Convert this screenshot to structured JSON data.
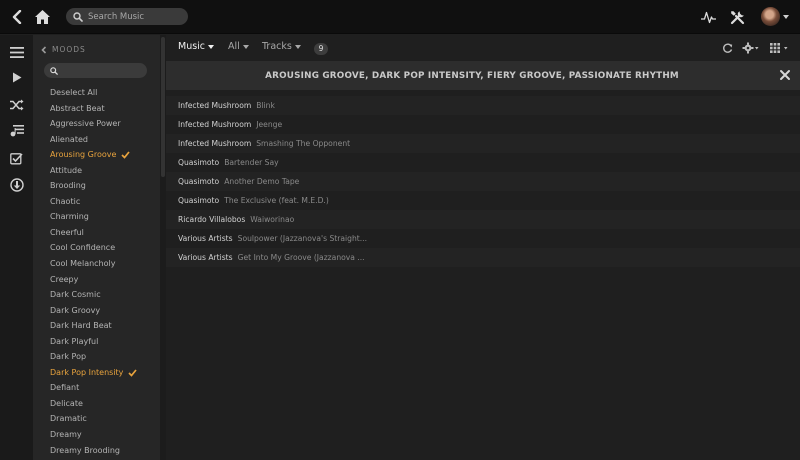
{
  "topbar": {
    "search_placeholder": "Search Music"
  },
  "rail": {
    "items": [
      "menu-icon",
      "play-icon",
      "shuffle-icon",
      "playlists-icon",
      "checklist-icon",
      "download-icon"
    ]
  },
  "moods": {
    "header": "MOODS",
    "items": [
      {
        "label": "Deselect All",
        "selected": false
      },
      {
        "label": "Abstract Beat",
        "selected": false
      },
      {
        "label": "Aggressive Power",
        "selected": false
      },
      {
        "label": "Alienated",
        "selected": false
      },
      {
        "label": "Arousing Groove",
        "selected": true
      },
      {
        "label": "Attitude",
        "selected": false
      },
      {
        "label": "Brooding",
        "selected": false
      },
      {
        "label": "Chaotic",
        "selected": false
      },
      {
        "label": "Charming",
        "selected": false
      },
      {
        "label": "Cheerful",
        "selected": false
      },
      {
        "label": "Cool Confidence",
        "selected": false
      },
      {
        "label": "Cool Melancholy",
        "selected": false
      },
      {
        "label": "Creepy",
        "selected": false
      },
      {
        "label": "Dark Cosmic",
        "selected": false
      },
      {
        "label": "Dark Groovy",
        "selected": false
      },
      {
        "label": "Dark Hard Beat",
        "selected": false
      },
      {
        "label": "Dark Playful",
        "selected": false
      },
      {
        "label": "Dark Pop",
        "selected": false
      },
      {
        "label": "Dark Pop Intensity",
        "selected": true
      },
      {
        "label": "Defiant",
        "selected": false
      },
      {
        "label": "Delicate",
        "selected": false
      },
      {
        "label": "Dramatic",
        "selected": false
      },
      {
        "label": "Dreamy",
        "selected": false
      },
      {
        "label": "Dreamy Brooding",
        "selected": false
      }
    ],
    "accent_color": "#e8a33d"
  },
  "main": {
    "tabs": {
      "music": "Music",
      "all": "All",
      "tracks": "Tracks"
    },
    "count": "9",
    "filter_title": "AROUSING GROOVE, DARK POP INTENSITY, FIERY GROOVE, PASSIONATE RHYTHM",
    "tracks": [
      {
        "artist": "Infected Mushroom",
        "title": "Blink"
      },
      {
        "artist": "Infected Mushroom",
        "title": "Jeenge"
      },
      {
        "artist": "Infected Mushroom",
        "title": "Smashing The Opponent"
      },
      {
        "artist": "Quasimoto",
        "title": "Bartender Say"
      },
      {
        "artist": "Quasimoto",
        "title": "Another Demo Tape"
      },
      {
        "artist": "Quasimoto",
        "title": "The Exclusive (feat. M.E.D.)"
      },
      {
        "artist": "Ricardo Villalobos",
        "title": "Waiworinao"
      },
      {
        "artist": "Various Artists",
        "title": "Soulpower (Jazzanova's Straight..."
      },
      {
        "artist": "Various Artists",
        "title": "Get Into My Groove (Jazzanova ..."
      }
    ]
  }
}
